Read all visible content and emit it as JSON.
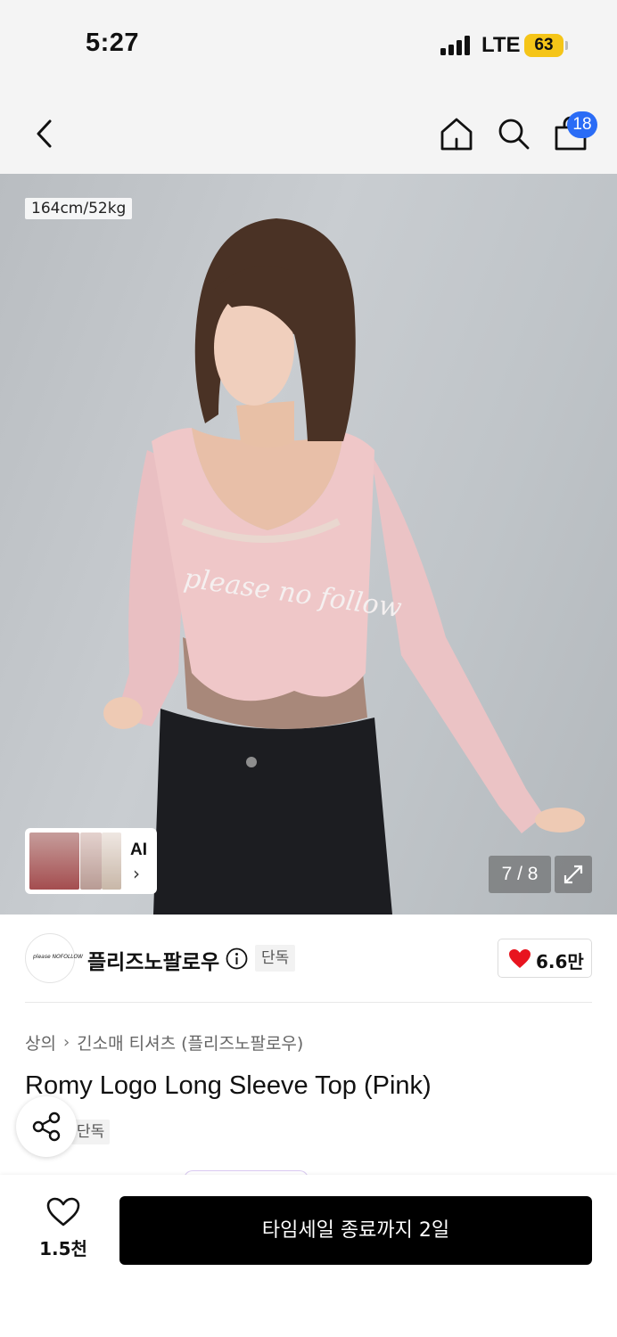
{
  "status_bar": {
    "time": "5:27",
    "network": "LTE",
    "battery": "63"
  },
  "nav": {
    "cart_count": "18"
  },
  "hero": {
    "model_size": "164cm/52kg",
    "ai_label": "AI",
    "image_index": "7 / 8",
    "shirt_print": "please no follow"
  },
  "brand": {
    "logo_text": "please NOFOLLOW",
    "name": "플리즈노팔로우",
    "exclusive_badge": "단독",
    "likes": "6.6만"
  },
  "breadcrumb": {
    "category": "상의",
    "subcategory": "긴소매 티셔츠 (플리즈노팔로우)"
  },
  "product": {
    "title": "Romy Logo Long Sleeve Top (Pink)",
    "exclusive_badge": "단독"
  },
  "bottom_bar": {
    "wish_count": "1.5천",
    "cta_label": "타임세일 종료까지 2일"
  },
  "colors": {
    "accent_blue": "#2a6cf6",
    "heart_red": "#e8141f",
    "cta_black": "#000000",
    "battery_yellow": "#f5c518"
  }
}
